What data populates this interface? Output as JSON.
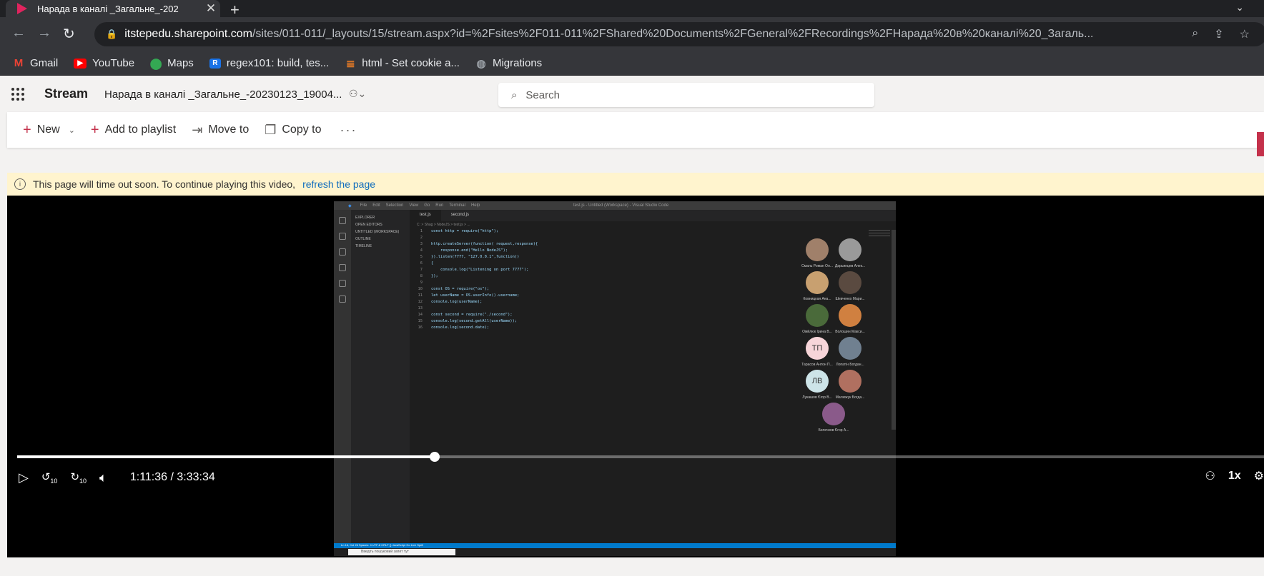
{
  "browser": {
    "tab_title": "Нарада в каналі _Загальне_-202",
    "url_host": "itstepedu.sharepoint.com",
    "url_path": "/sites/011-011/_layouts/15/stream.aspx?id=%2Fsites%2F011-011%2FShared%20Documents%2FGeneral%2FRecordings%2FНарада%20в%20каналі%20_Загаль...",
    "bookmarks": [
      {
        "label": "Gmail",
        "icon": "gmail-icon",
        "color": "#ea4335"
      },
      {
        "label": "YouTube",
        "icon": "youtube-icon",
        "color": "#ff0000"
      },
      {
        "label": "Maps",
        "icon": "maps-icon",
        "color": "#34a853"
      },
      {
        "label": "regex101: build, tes...",
        "icon": "regex101-icon",
        "color": "#1a73e8"
      },
      {
        "label": "html - Set cookie a...",
        "icon": "stackoverflow-icon",
        "color": "#f48024"
      },
      {
        "label": "Migrations",
        "icon": "globe-icon",
        "color": "#9aa0a6"
      }
    ]
  },
  "app": {
    "brand": "Stream",
    "doc_title": "Нарада в каналі _Загальне_-20230123_19004...",
    "search_placeholder": "Search"
  },
  "commands": {
    "new": "New",
    "add_to_playlist": "Add to playlist",
    "move_to": "Move to",
    "copy_to": "Copy to"
  },
  "notice": {
    "text": "This page will time out soon. To continue playing this video,",
    "link": "refresh the page"
  },
  "player": {
    "time": "1:11:36 / 3:33:34",
    "progress": 0.335,
    "speed": "1x",
    "seek_back": "10",
    "seek_forward": "10"
  },
  "video": {
    "vscode_title": "test.js - Untitled (Workspace) - Visual Studio Code",
    "menu": [
      "File",
      "Edit",
      "Selection",
      "View",
      "Go",
      "Run",
      "Terminal",
      "Help"
    ],
    "sidebar": [
      "EXPLORER",
      "OPEN EDITORS",
      "UNTITLED (WORKSPACE)",
      "OUTLINE",
      "TIMELINE"
    ],
    "tabs": [
      "test.js",
      "second.js"
    ],
    "breadcrumb": "C: > Shag > NodeJS > test.js > ...",
    "code": [
      "const http = require(\"http\");",
      "",
      "http.createServer(function( request,response){",
      "    response.end(\"Hello NodeJS\");",
      "}).listen(7777, \"127.0.0.1\",function()",
      "{",
      "    console.log(\"Listening on port 7777\");",
      "});",
      "",
      "const OS = require(\"os\");",
      "let userName = OS.userInfo().username;",
      "console.log(userName);",
      "",
      "const second = require(\"./second\");",
      "console.log(second.getAll(userName));",
      "console.log(second.date);"
    ],
    "status": "Ln 16, Col 26   Spaces: 4   UTF-8   CRLF   {} JavaScript   Go Live   Spell",
    "taskbar_search": "Введіть пошуковий запит тут",
    "participants": [
      {
        "name": "Смаль Роман Ол...",
        "initials": "",
        "color": "#a0806a"
      },
      {
        "name": "Дарьинцев Алек...",
        "initials": "",
        "color": "#9a9a9a"
      },
      {
        "name": "Ковницкая Ана...",
        "initials": "",
        "color": "#c8a070"
      },
      {
        "name": "Шевченко Мари...",
        "initials": "",
        "color": "#5a4a40"
      },
      {
        "name": "Омйлюк Ірина В...",
        "initials": "",
        "color": "#4a6a3a"
      },
      {
        "name": "Волошин Макси...",
        "initials": "",
        "color": "#d08040"
      },
      {
        "name": "Тарасов Антон П...",
        "initials": "ТП",
        "color": "#f7d5d9"
      },
      {
        "name": "Лопатін Богдан...",
        "initials": "",
        "color": "#708090"
      },
      {
        "name": "Лукашов Єгор В...",
        "initials": "ЛВ",
        "color": "#cde4e8"
      },
      {
        "name": "Малюжук Богда...",
        "initials": "",
        "color": "#b07060"
      },
      {
        "name": "Белечков Єгор А...",
        "initials": "",
        "color": "#8a5a8a"
      }
    ]
  }
}
